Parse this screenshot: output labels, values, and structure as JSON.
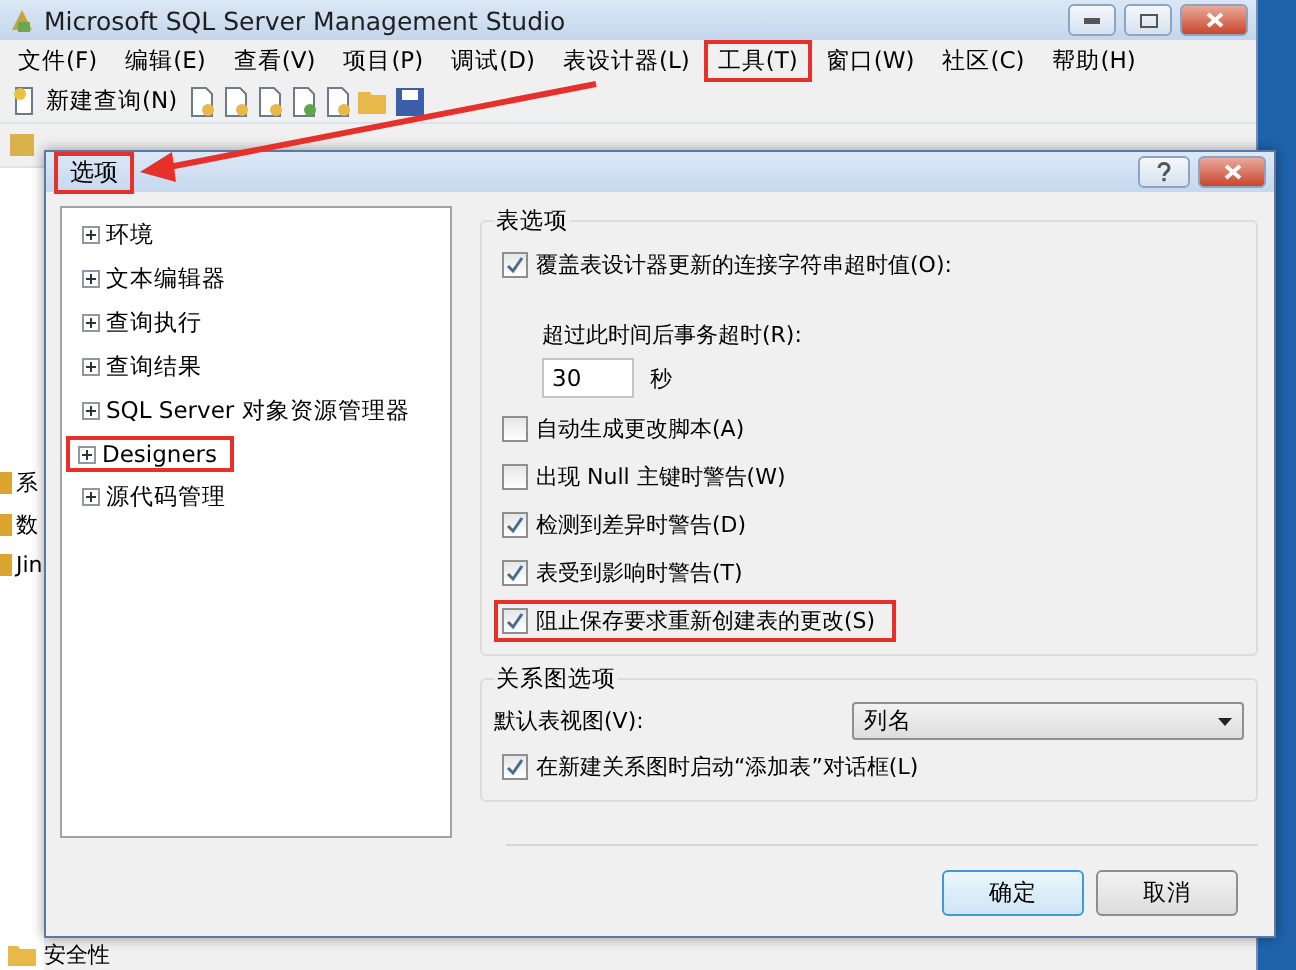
{
  "app": {
    "title": "Microsoft SQL Server Management Studio"
  },
  "menu": [
    {
      "label": "文件(F)",
      "highlighted": false
    },
    {
      "label": "编辑(E)",
      "highlighted": false
    },
    {
      "label": "查看(V)",
      "highlighted": false
    },
    {
      "label": "项目(P)",
      "highlighted": false
    },
    {
      "label": "调试(D)",
      "highlighted": false
    },
    {
      "label": "表设计器(L)",
      "highlighted": false
    },
    {
      "label": "工具(T)",
      "highlighted": true
    },
    {
      "label": "窗口(W)",
      "highlighted": false
    },
    {
      "label": "社区(C)",
      "highlighted": false
    },
    {
      "label": "帮助(H)",
      "highlighted": false
    }
  ],
  "toolbar": {
    "new_query": "新建查询(N)"
  },
  "explorer": {
    "items": [
      "系",
      "数",
      "Jin"
    ],
    "bottom_item": "安全性"
  },
  "dialog": {
    "title": "选项",
    "title_highlighted": true,
    "tree": [
      {
        "label": "环境",
        "highlighted": false
      },
      {
        "label": "文本编辑器",
        "highlighted": false
      },
      {
        "label": "查询执行",
        "highlighted": false
      },
      {
        "label": "查询结果",
        "highlighted": false
      },
      {
        "label": "SQL Server 对象资源管理器",
        "highlighted": false
      },
      {
        "label": "Designers",
        "highlighted": true
      },
      {
        "label": "源代码管理",
        "highlighted": false
      }
    ],
    "table_options": {
      "title": "表选项",
      "options": [
        {
          "kind": "checkbox",
          "label": "覆盖表设计器更新的连接字符串超时值(O):",
          "checked": true,
          "highlighted": false
        },
        {
          "kind": "timeout",
          "label": "超过此时间后事务超时(R):",
          "value": "30",
          "unit": "秒"
        },
        {
          "kind": "checkbox",
          "label": "自动生成更改脚本(A)",
          "checked": false,
          "highlighted": false
        },
        {
          "kind": "checkbox",
          "label": "出现 Null 主键时警告(W)",
          "checked": false,
          "highlighted": false
        },
        {
          "kind": "checkbox",
          "label": "检测到差异时警告(D)",
          "checked": true,
          "highlighted": false
        },
        {
          "kind": "checkbox",
          "label": "表受到影响时警告(T)",
          "checked": true,
          "highlighted": false
        },
        {
          "kind": "checkbox",
          "label": "阻止保存要求重新创建表的更改(S)",
          "checked": true,
          "highlighted": true
        }
      ]
    },
    "diagram_options": {
      "title": "关系图选项",
      "default_view_label": "默认表视图(V):",
      "default_view": "列名",
      "options": [
        {
          "kind": "checkbox",
          "label": "在新建关系图时启动“添加表”对话框(L)",
          "checked": true,
          "highlighted": false
        }
      ]
    },
    "buttons": [
      {
        "label": "确定",
        "default": true
      },
      {
        "label": "取消",
        "default": false
      }
    ]
  }
}
